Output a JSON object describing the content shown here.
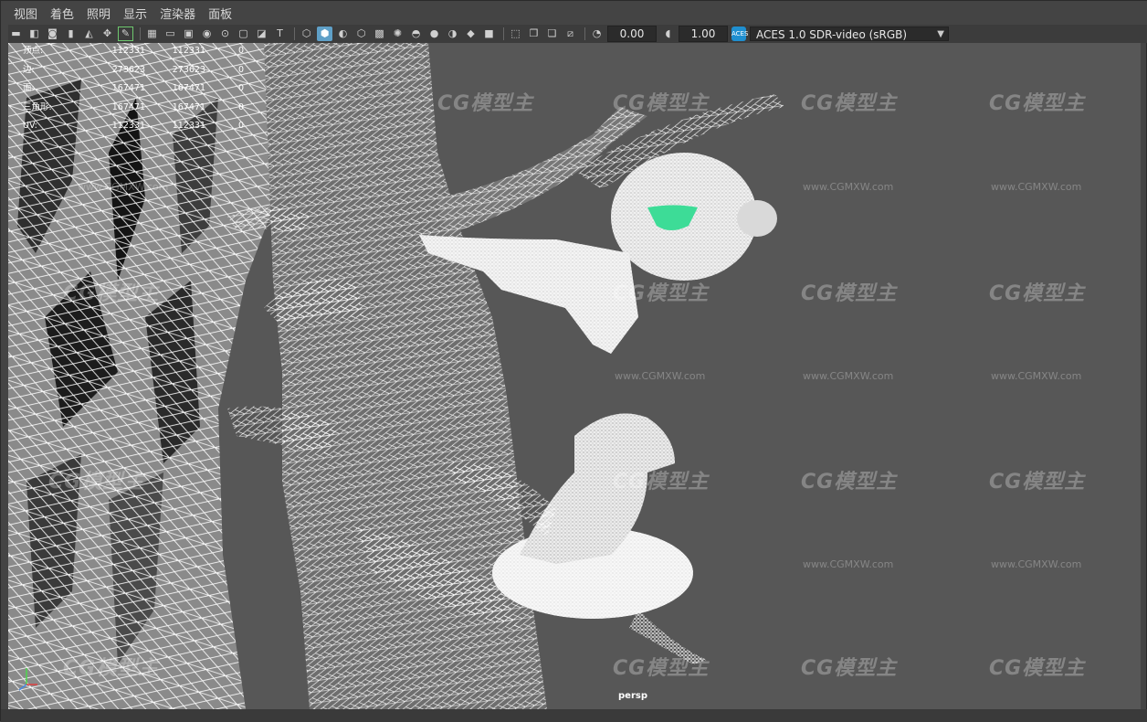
{
  "menu": [
    "视图",
    "着色",
    "照明",
    "显示",
    "渲染器",
    "面板"
  ],
  "toolbar": {
    "exposure_value": "0.00",
    "gamma_value": "1.00",
    "colorspace_icon": "ACES",
    "colorspace": "ACES 1.0 SDR-video (sRGB)"
  },
  "hud": {
    "rows": [
      {
        "label": "顶点:",
        "v1": "112331",
        "v2": "112331",
        "v3": "0"
      },
      {
        "label": "边:",
        "v1": "273623",
        "v2": "273623",
        "v3": "0"
      },
      {
        "label": "面:",
        "v1": "167471",
        "v2": "167471",
        "v3": "0"
      },
      {
        "label": "三角形:",
        "v1": "167471",
        "v2": "167471",
        "v3": "0"
      },
      {
        "label": "UV:",
        "v1": "112331",
        "v2": "112331",
        "v3": "0"
      }
    ]
  },
  "camera_label": "persp",
  "watermark": {
    "brand": "CG模型主",
    "url": "www.CGMXW.com"
  },
  "colors": {
    "viewport_bg": "#575757",
    "wire": "#ffffff",
    "accent_green": "#3ddc97",
    "active_tool": "#5fa0c8"
  }
}
